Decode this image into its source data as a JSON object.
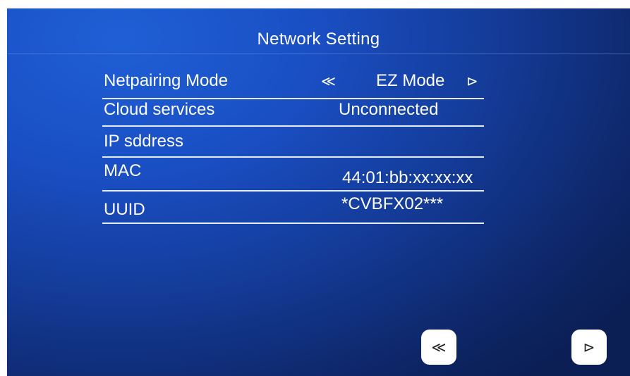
{
  "title": "Network Setting",
  "rows": [
    {
      "label": "Netpairing Mode",
      "value": "EZ Mode",
      "prev_icon": "≪",
      "next_icon": "⊳"
    },
    {
      "label": "Cloud services",
      "value": "Unconnected"
    },
    {
      "label": "IP sddress",
      "value": ""
    },
    {
      "label": "MAC",
      "value": "44:01:bb:xx:xx:xx"
    },
    {
      "label": "UUID",
      "value": "*CVBFX02***"
    }
  ],
  "nav": {
    "prev_icon": "≪",
    "next_icon": "⊳"
  },
  "colors": {
    "background_light": "#1f5fd6",
    "background_dark": "#0b1f55",
    "text": "#ffffff",
    "button": "#ffffff"
  }
}
